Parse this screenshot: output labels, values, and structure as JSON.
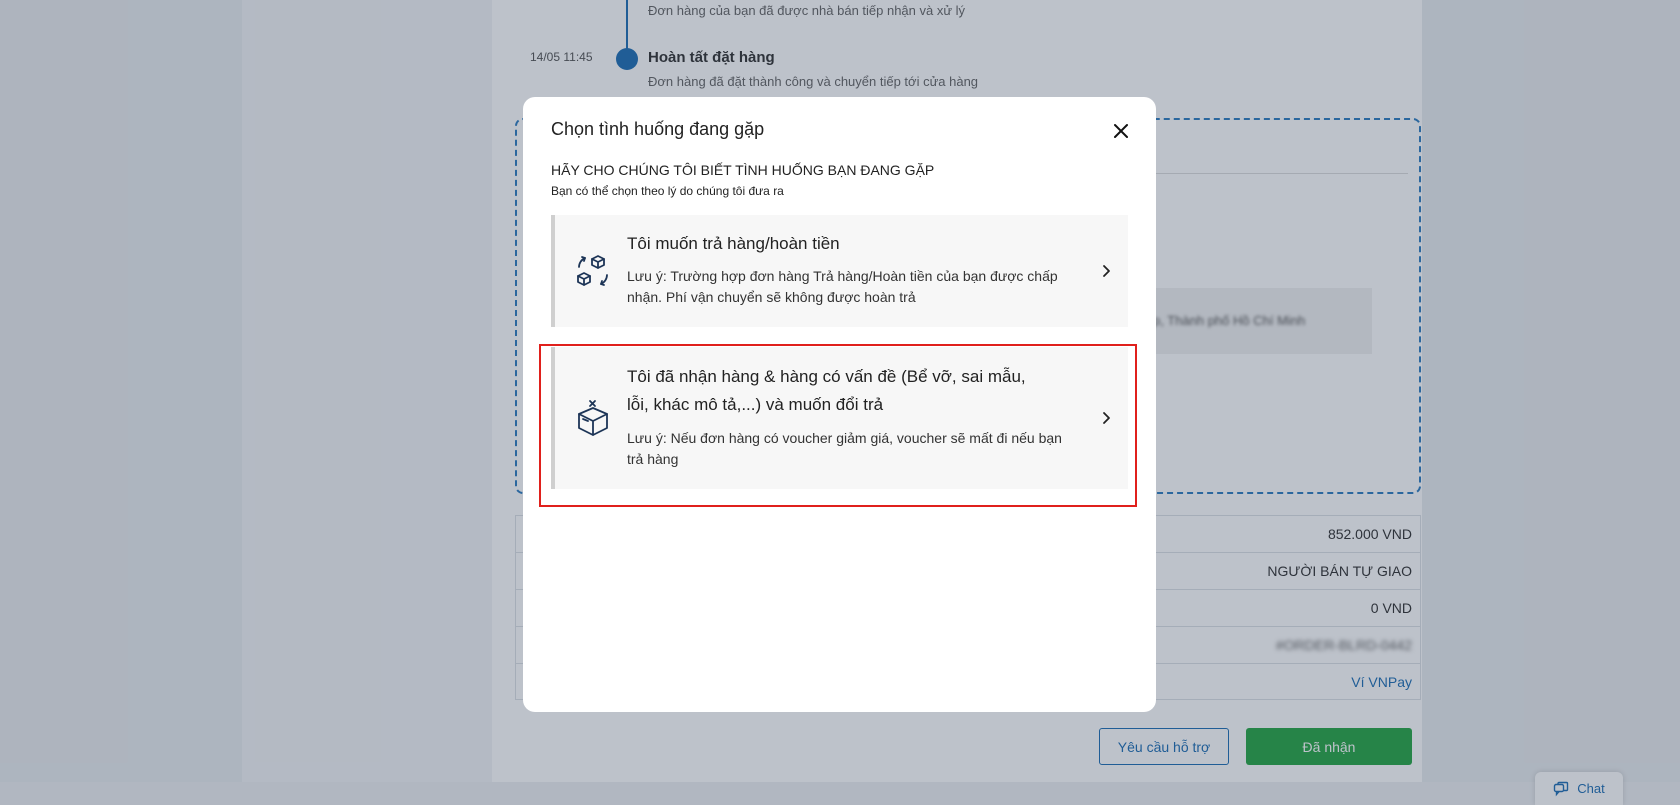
{
  "background": {
    "timeline": {
      "prev_desc": "Đơn hàng của bạn đã được nhà bán tiếp nhận và xử lý",
      "time": "14/05 11:45",
      "title": "Hoàn tất đặt hàng",
      "desc": "Đơn hàng đã đặt thành công và chuyển tiếp tới cửa hàng"
    },
    "address_blurred": "p, Thành phố Hồ Chí Minh",
    "summary_rows": [
      {
        "value": "852.000 VND",
        "style": "normal"
      },
      {
        "value": "NGƯỜI BÁN TỰ GIAO",
        "style": "normal"
      },
      {
        "value": "0 VND",
        "style": "normal"
      },
      {
        "value": "#ORDER-BLRD-0442",
        "style": "blurred"
      },
      {
        "value": "Ví VNPay",
        "style": "link"
      }
    ],
    "buttons": {
      "support": "Yêu cầu hỗ trợ",
      "received": "Đã nhận"
    },
    "chat_label": "Chat"
  },
  "modal": {
    "title": "Chọn tình huống đang gặp",
    "heading": "HÃY CHO CHÚNG TÔI BIẾT TÌNH HUỐNG BẠN ĐANG GẶP",
    "subheading": "Bạn có thể chọn theo lý do chúng tôi đưa ra",
    "options": [
      {
        "icon": "return-refund-icon",
        "title": "Tôi muốn trả hàng/hoàn tiền",
        "note": "Lưu ý: Trường hợp đơn hàng Trả hàng/Hoàn tiền của bạn được chấp nhận. Phí vận chuyển sẽ không được hoàn trả"
      },
      {
        "icon": "damaged-box-icon",
        "title": "Tôi đã nhận hàng & hàng có vấn đề (Bể vỡ, sai mẫu, lỗi, khác mô tả,...) và muốn đổi trả",
        "note": "Lưu ý: Nếu đơn hàng có voucher giảm giá, voucher sẽ mất đi nếu bạn trả hàng"
      }
    ]
  },
  "colors": {
    "primary_blue": "#1f6fb5",
    "success_green": "#28a745",
    "highlight_red": "#e0201c"
  }
}
